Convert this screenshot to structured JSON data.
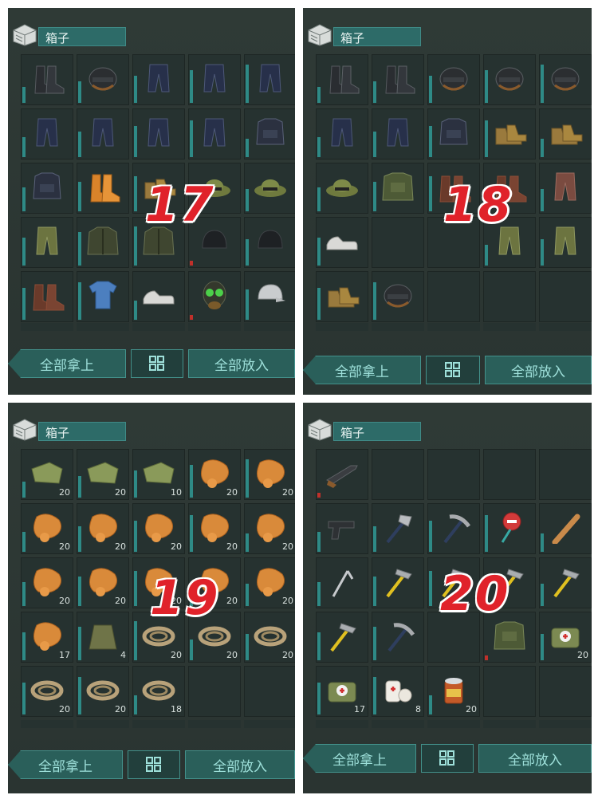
{
  "colors": {
    "accent": "#2d6b68",
    "durability": "#2e8a86",
    "low_durability": "#c0302a",
    "label_red": "#e0222a"
  },
  "panels": [
    {
      "id": "p17",
      "number": "17",
      "title": "箱子",
      "buttons": {
        "take_all": "全部拿上",
        "grid_icon": "grid-icon",
        "put_all": "全部放入"
      },
      "slots": [
        {
          "icon": "boots-icon",
          "qty": ""
        },
        {
          "icon": "helmet-icon",
          "qty": ""
        },
        {
          "icon": "pants-icon",
          "qty": ""
        },
        {
          "icon": "pants-icon",
          "qty": ""
        },
        {
          "icon": "pants-icon",
          "qty": ""
        },
        {
          "icon": "pants-icon",
          "qty": ""
        },
        {
          "icon": "pants-icon",
          "qty": ""
        },
        {
          "icon": "pants-icon",
          "qty": ""
        },
        {
          "icon": "pants-icon",
          "qty": ""
        },
        {
          "icon": "vest-icon",
          "qty": ""
        },
        {
          "icon": "vest-icon",
          "qty": ""
        },
        {
          "icon": "orange-boots-icon",
          "qty": ""
        },
        {
          "icon": "tan-boots-icon",
          "qty": ""
        },
        {
          "icon": "boonie-hat-icon",
          "qty": ""
        },
        {
          "icon": "boonie-hat-icon",
          "qty": ""
        },
        {
          "icon": "camo-pants-icon",
          "qty": ""
        },
        {
          "icon": "jacket-icon",
          "qty": ""
        },
        {
          "icon": "jacket-icon",
          "qty": ""
        },
        {
          "icon": "beanie-icon",
          "qty": ""
        },
        {
          "icon": "beanie-icon",
          "qty": ""
        },
        {
          "icon": "brown-boots-icon",
          "qty": ""
        },
        {
          "icon": "shirt-icon",
          "qty": ""
        },
        {
          "icon": "sneakers-icon",
          "qty": ""
        },
        {
          "icon": "gas-mask-icon",
          "qty": ""
        },
        {
          "icon": "cap-icon",
          "qty": ""
        }
      ]
    },
    {
      "id": "p18",
      "number": "18",
      "title": "箱子",
      "buttons": {
        "take_all": "全部拿上",
        "grid_icon": "grid-icon",
        "put_all": "全部放入"
      },
      "slots": [
        {
          "icon": "boots-icon",
          "qty": ""
        },
        {
          "icon": "boots-icon",
          "qty": ""
        },
        {
          "icon": "helmet-icon",
          "qty": ""
        },
        {
          "icon": "helmet-icon",
          "qty": ""
        },
        {
          "icon": "helmet-icon",
          "qty": ""
        },
        {
          "icon": "pants-icon",
          "qty": ""
        },
        {
          "icon": "pants-icon",
          "qty": ""
        },
        {
          "icon": "vest-icon",
          "qty": ""
        },
        {
          "icon": "tan-boots-icon",
          "qty": ""
        },
        {
          "icon": "tan-boots-icon",
          "qty": ""
        },
        {
          "icon": "boonie-hat-icon",
          "qty": ""
        },
        {
          "icon": "camo-vest-icon",
          "qty": ""
        },
        {
          "icon": "brown-boots-icon",
          "qty": ""
        },
        {
          "icon": "brown-boots-icon",
          "qty": ""
        },
        {
          "icon": "brown-pants-icon",
          "qty": ""
        },
        {
          "icon": "sneakers-icon",
          "qty": ""
        },
        {
          "icon": "",
          "qty": ""
        },
        {
          "icon": "",
          "qty": ""
        },
        {
          "icon": "camo-pants-icon",
          "qty": ""
        },
        {
          "icon": "camo-pants-icon",
          "qty": ""
        },
        {
          "icon": "tan-boots-icon",
          "qty": ""
        },
        {
          "icon": "helmet-icon",
          "qty": ""
        },
        {
          "icon": "",
          "qty": ""
        },
        {
          "icon": "",
          "qty": ""
        },
        {
          "icon": "",
          "qty": ""
        }
      ]
    },
    {
      "id": "p19",
      "number": "19",
      "title": "箱子",
      "buttons": {
        "take_all": "全部拿上",
        "grid_icon": "grid-icon",
        "put_all": "全部放入"
      },
      "slots": [
        {
          "icon": "cloth-icon",
          "qty": "20"
        },
        {
          "icon": "cloth-icon",
          "qty": "20"
        },
        {
          "icon": "cloth-icon",
          "qty": "10"
        },
        {
          "icon": "leather-icon",
          "qty": "20"
        },
        {
          "icon": "leather-icon",
          "qty": "20"
        },
        {
          "icon": "leather-icon",
          "qty": "20"
        },
        {
          "icon": "leather-icon",
          "qty": "20"
        },
        {
          "icon": "leather-icon",
          "qty": "20"
        },
        {
          "icon": "leather-icon",
          "qty": "20"
        },
        {
          "icon": "leather-icon",
          "qty": "20"
        },
        {
          "icon": "leather-icon",
          "qty": "20"
        },
        {
          "icon": "leather-icon",
          "qty": "20"
        },
        {
          "icon": "leather-icon",
          "qty": "20"
        },
        {
          "icon": "leather-icon",
          "qty": "20"
        },
        {
          "icon": "leather-icon",
          "qty": "20"
        },
        {
          "icon": "leather-icon",
          "qty": "17"
        },
        {
          "icon": "sack-icon",
          "qty": "4"
        },
        {
          "icon": "rope-icon",
          "qty": "20"
        },
        {
          "icon": "rope-icon",
          "qty": "20"
        },
        {
          "icon": "rope-icon",
          "qty": "20"
        },
        {
          "icon": "rope-icon",
          "qty": "20"
        },
        {
          "icon": "rope-icon",
          "qty": "20"
        },
        {
          "icon": "rope-icon",
          "qty": "18"
        },
        {
          "icon": "",
          "qty": ""
        },
        {
          "icon": "",
          "qty": ""
        }
      ]
    },
    {
      "id": "p20",
      "number": "20",
      "title": "箱子",
      "buttons": {
        "take_all": "全部拿上",
        "grid_icon": "grid-icon",
        "put_all": "全部放入"
      },
      "slots": [
        {
          "icon": "shotgun-icon",
          "qty": ""
        },
        {
          "icon": "",
          "qty": ""
        },
        {
          "icon": "",
          "qty": ""
        },
        {
          "icon": "",
          "qty": ""
        },
        {
          "icon": "",
          "qty": ""
        },
        {
          "icon": "pistol-icon",
          "qty": ""
        },
        {
          "icon": "hatchet-icon",
          "qty": ""
        },
        {
          "icon": "pickaxe-icon",
          "qty": ""
        },
        {
          "icon": "stop-sign-icon",
          "qty": ""
        },
        {
          "icon": "bat-icon",
          "qty": ""
        },
        {
          "icon": "hoe-icon",
          "qty": ""
        },
        {
          "icon": "hammer-icon",
          "qty": ""
        },
        {
          "icon": "hammer-icon",
          "qty": ""
        },
        {
          "icon": "hammer-icon",
          "qty": ""
        },
        {
          "icon": "hammer-icon",
          "qty": ""
        },
        {
          "icon": "hammer-icon",
          "qty": ""
        },
        {
          "icon": "pickaxe-icon",
          "qty": ""
        },
        {
          "icon": "",
          "qty": ""
        },
        {
          "icon": "camo-vest-icon",
          "qty": ""
        },
        {
          "icon": "medkit-icon",
          "qty": "20"
        },
        {
          "icon": "medkit-icon",
          "qty": "17"
        },
        {
          "icon": "bandage-icon",
          "qty": "8"
        },
        {
          "icon": "canned-food-icon",
          "qty": "20"
        },
        {
          "icon": "",
          "qty": ""
        },
        {
          "icon": "",
          "qty": ""
        }
      ]
    }
  ]
}
